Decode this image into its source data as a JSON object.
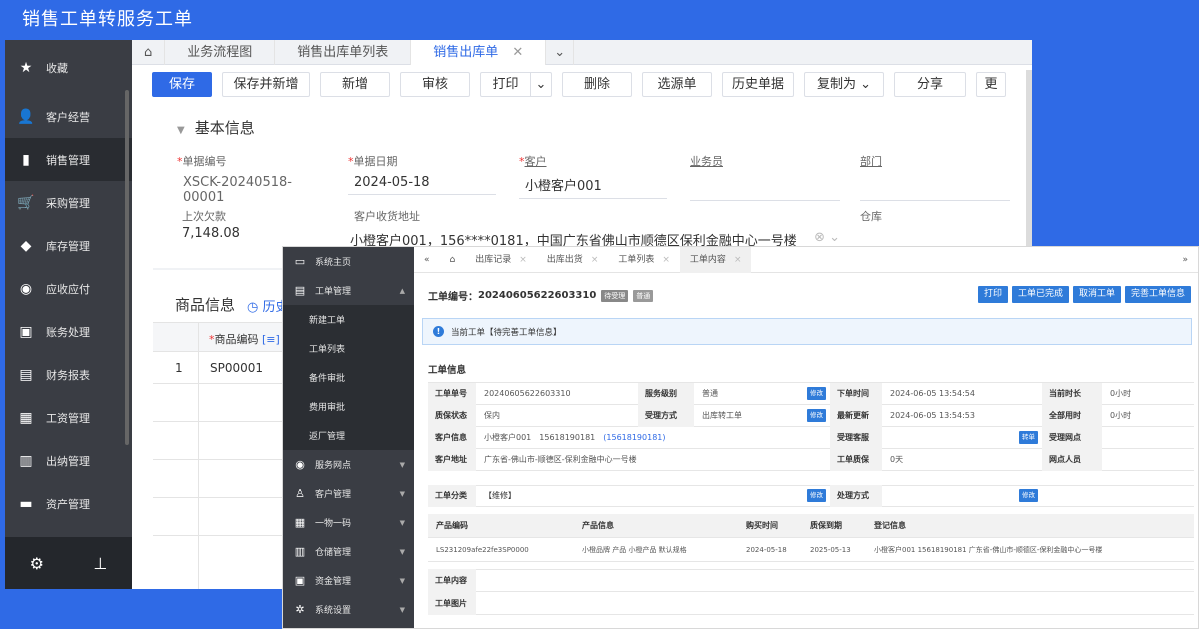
{
  "caption": "销售工单转服务工单",
  "w1": {
    "sidebar": [
      {
        "label": "收藏",
        "icon": "star-icon"
      },
      {
        "label": "客户经营",
        "icon": "users-icon"
      },
      {
        "label": "销售管理",
        "icon": "bar-chart-icon",
        "active": true
      },
      {
        "label": "采购管理",
        "icon": "cart-icon"
      },
      {
        "label": "库存管理",
        "icon": "box-icon"
      },
      {
        "label": "应收应付",
        "icon": "coin-icon"
      },
      {
        "label": "账务处理",
        "icon": "ledger-icon"
      },
      {
        "label": "财务报表",
        "icon": "report-icon"
      },
      {
        "label": "工资管理",
        "icon": "wage-icon"
      },
      {
        "label": "出纳管理",
        "icon": "cashier-icon"
      },
      {
        "label": "资产管理",
        "icon": "asset-icon"
      }
    ],
    "tabs": [
      "业务流程图",
      "销售出库单列表",
      "销售出库单"
    ],
    "toolbar": [
      "保存",
      "保存并新增",
      "新增",
      "审核",
      "打印",
      "删除",
      "选源单",
      "历史单据",
      "复制为",
      "分享",
      "更"
    ],
    "section_title": "基本信息",
    "fields": {
      "doc_no_label": "单据编号",
      "doc_no": "XSCK-20240518-00001",
      "date_label": "单据日期",
      "date": "2024-05-18",
      "customer_label": "客户",
      "customer": "小橙客户001",
      "salesman_label": "业务员",
      "dept_label": "部门",
      "debt_label": "上次欠款",
      "debt": "7,148.08",
      "addr_label": "客户收货地址",
      "addr": "小橙客户001，156****0181，中国广东省佛山市顺德区保利金融中心一号楼",
      "warehouse_label": "仓库"
    },
    "goods": {
      "title": "商品信息",
      "history": "历史",
      "col_code": "商品编码",
      "row_no": "1",
      "row_code": "SP00001"
    }
  },
  "w2": {
    "sidebar": [
      {
        "label": "系统主页",
        "icon": "monitor-icon"
      },
      {
        "label": "工单管理",
        "icon": "doc-icon",
        "expanded": true
      }
    ],
    "sub": [
      "新建工单",
      "工单列表",
      "备件审批",
      "费用审批",
      "返厂管理"
    ],
    "sidebar_rest": [
      {
        "label": "服务网点",
        "icon": "location-icon"
      },
      {
        "label": "客户管理",
        "icon": "person-icon"
      },
      {
        "label": "一物一码",
        "icon": "grid-icon"
      },
      {
        "label": "仓储管理",
        "icon": "warehouse-icon"
      },
      {
        "label": "资金管理",
        "icon": "money-icon"
      },
      {
        "label": "系统设置",
        "icon": "settings-icon"
      }
    ],
    "tabs": [
      "出库记录",
      "出库出货",
      "工单列表",
      "工单内容"
    ],
    "header": {
      "label": "工单编号：",
      "no": "20240605622603310",
      "tag1": "待受理",
      "tag2": "普通"
    },
    "buttons": [
      "打印",
      "工单已完成",
      "取消工单",
      "完善工单信息"
    ],
    "notice": "当前工单【待完善工单信息】",
    "info_title": "工单信息",
    "info": {
      "k_no": "工单单号",
      "v_no": "20240605622603310",
      "k_level": "服务级别",
      "v_level": "普通",
      "k_time": "下单时间",
      "v_time": "2024-06-05 13:54:54",
      "k_dur": "当前时长",
      "v_dur": "0小时",
      "k_warr": "质保状态",
      "v_warr": "保内",
      "k_mode": "受理方式",
      "v_mode": "出库转工单",
      "k_upd": "最新更新",
      "v_upd": "2024-06-05 13:54:53",
      "k_all": "全部用时",
      "v_all": "0小时",
      "k_cust": "客户信息",
      "v_cust": "小橙客户001　15618190181",
      "v_cust_link": "(15618190181)",
      "k_svc": "受理客服",
      "k_net": "受理网点",
      "k_addr": "客户地址",
      "v_addr": "广东省-佛山市-顺德区-保利金融中心一号楼",
      "k_wq": "工单质保",
      "v_wq": "0天",
      "k_staff": "网点人员",
      "edit": "修改",
      "transfer": "转单"
    },
    "category": {
      "k": "工单分类",
      "v": "【维修】",
      "k2": "处理方式"
    },
    "products": {
      "headers": [
        "产品编码",
        "产品信息",
        "购买时间",
        "质保到期",
        "登记信息"
      ],
      "row": [
        "LS231209afe22fe3SP0000",
        "小橙品牌 产品 小橙产品 默认规格",
        "2024-05-18",
        "2025-05-13",
        "小橙客户001 15618190181 广东省-佛山市-顺德区-保利金融中心一号楼"
      ]
    },
    "extra": [
      "工单内容",
      "工单图片"
    ]
  }
}
